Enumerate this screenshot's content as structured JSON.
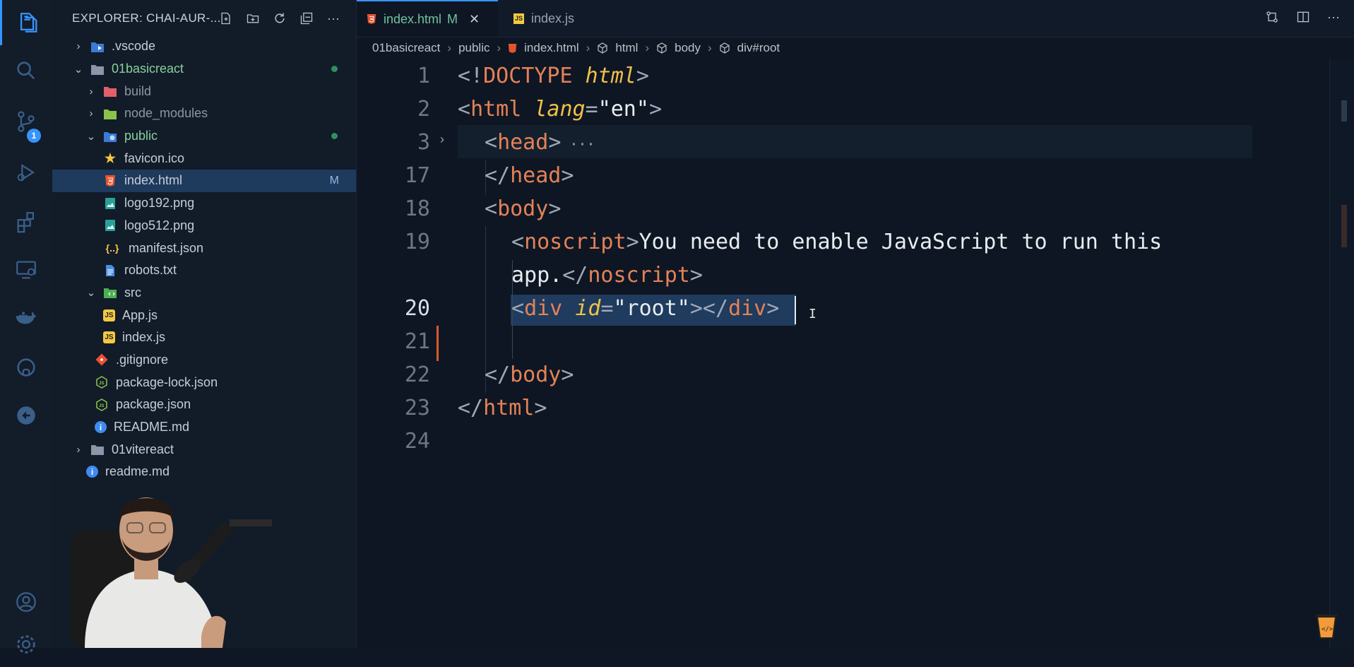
{
  "activity_bar": {
    "source_control_badge": "1",
    "items": [
      "explorer-icon",
      "search-icon",
      "source-control-icon",
      "run-debug-icon",
      "extensions-icon",
      "remote-explorer-icon",
      "docker-icon",
      "github-icon",
      "live-share-icon",
      "account-icon",
      "settings-icon"
    ]
  },
  "explorer": {
    "title": "EXPLORER: CHAI-AUR-...",
    "tree": [
      {
        "label": ".vscode",
        "indent": 1,
        "expanded": false,
        "icon": "vscode-folder-icon"
      },
      {
        "label": "01basicreact",
        "indent": 1,
        "expanded": true,
        "icon": "folder-icon",
        "modified": true
      },
      {
        "label": "build",
        "indent": 2,
        "expanded": false,
        "icon": "build-folder-icon"
      },
      {
        "label": "node_modules",
        "indent": 2,
        "expanded": false,
        "icon": "node-folder-icon"
      },
      {
        "label": "public",
        "indent": 2,
        "expanded": true,
        "icon": "public-folder-icon",
        "modified": true
      },
      {
        "label": "favicon.ico",
        "indent": 3,
        "icon": "star-icon"
      },
      {
        "label": "index.html",
        "indent": 3,
        "icon": "html-icon",
        "selected": true,
        "status": "M"
      },
      {
        "label": "logo192.png",
        "indent": 3,
        "icon": "image-icon"
      },
      {
        "label": "logo512.png",
        "indent": 3,
        "icon": "image-icon"
      },
      {
        "label": "manifest.json",
        "indent": 3,
        "icon": "json-icon"
      },
      {
        "label": "robots.txt",
        "indent": 3,
        "icon": "text-icon"
      },
      {
        "label": "src",
        "indent": 2,
        "expanded": true,
        "icon": "src-folder-icon"
      },
      {
        "label": "App.js",
        "indent": 3,
        "icon": "js-icon"
      },
      {
        "label": "index.js",
        "indent": 3,
        "icon": "js-icon"
      },
      {
        "label": ".gitignore",
        "indent": 2,
        "icon": "git-icon"
      },
      {
        "label": "package-lock.json",
        "indent": 2,
        "icon": "npm-icon"
      },
      {
        "label": "package.json",
        "indent": 2,
        "icon": "npm-icon"
      },
      {
        "label": "README.md",
        "indent": 2,
        "icon": "info-icon"
      },
      {
        "label": "01vitereact",
        "indent": 1,
        "expanded": false,
        "icon": "folder-icon"
      },
      {
        "label": "readme.md",
        "indent": 1,
        "icon": "info-icon"
      }
    ]
  },
  "tabs": [
    {
      "label": "index.html",
      "status": "M",
      "active": true,
      "icon": "html-icon"
    },
    {
      "label": "index.js",
      "active": false,
      "icon": "js-icon"
    }
  ],
  "breadcrumbs": [
    "01basicreact",
    "public",
    "index.html",
    "html",
    "body",
    "div#root"
  ],
  "code": {
    "lines": [
      {
        "num": "1",
        "text": "<!DOCTYPE html>"
      },
      {
        "num": "2",
        "text": "<html lang=\"en\">"
      },
      {
        "num": "3",
        "text": "<head>···"
      },
      {
        "num": "17",
        "text": "</head>"
      },
      {
        "num": "18",
        "text": "<body>"
      },
      {
        "num": "19",
        "text": "<noscript>You need to enable JavaScript to run this"
      },
      {
        "num": "",
        "text": "app.</noscript>"
      },
      {
        "num": "20",
        "text": "<div id=\"root\"></div>"
      },
      {
        "num": "21",
        "text": ""
      },
      {
        "num": "22",
        "text": "</body>"
      },
      {
        "num": "23",
        "text": "</html>"
      },
      {
        "num": "24",
        "text": ""
      }
    ],
    "current_line": "20"
  },
  "colors": {
    "accent": "#3794ff",
    "tag": "#e48257",
    "attribute": "#f0c049",
    "selection": "#1f3b5e"
  }
}
